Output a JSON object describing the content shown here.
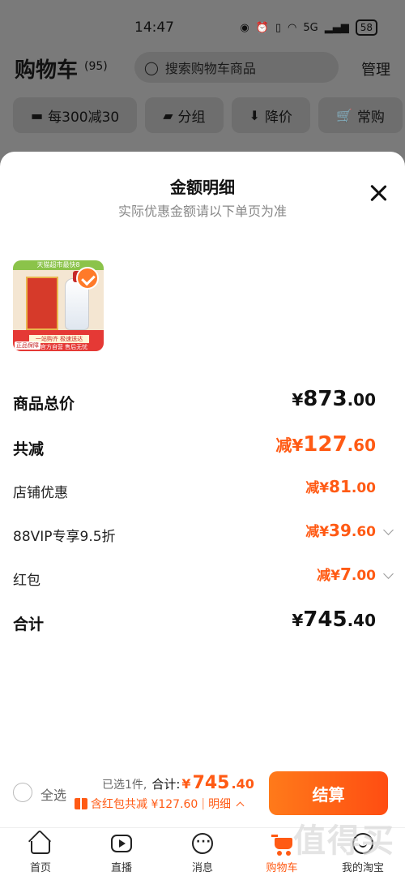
{
  "status_bar": {
    "time": "14:47",
    "network": "5G",
    "battery": "58"
  },
  "header": {
    "title": "购物车",
    "count": "(95)",
    "search_placeholder": "搜索购物车商品",
    "manage": "管理"
  },
  "chips": [
    {
      "label": "每300减30",
      "icon": "coupon-icon"
    },
    {
      "label": "分组",
      "icon": "folder-icon"
    },
    {
      "label": "降价",
      "icon": "price-down-icon"
    },
    {
      "label": "常购",
      "icon": "cart-icon"
    }
  ],
  "sheet": {
    "title": "金额明细",
    "subtitle": "实际优惠金额请以下单页为准",
    "product_thumb": {
      "banner": "天猫超市最快8",
      "strip": "一站购齐 极速送达",
      "strip2": "官方自营 售后无忧",
      "badge": "正品保障"
    },
    "rows": [
      {
        "label": "商品总价",
        "prefix": "",
        "yen": "¥",
        "int": "873",
        "dec": ".00"
      },
      {
        "label": "共减",
        "prefix": "减",
        "yen": "¥",
        "int": "127",
        "dec": ".60"
      },
      {
        "label": "店铺优惠",
        "prefix": "减",
        "yen": "¥",
        "int": "81",
        "dec": ".00"
      },
      {
        "label": "88VIP专享9.5折",
        "prefix": "减",
        "yen": "¥",
        "int": "39",
        "dec": ".60"
      },
      {
        "label": "红包",
        "prefix": "减",
        "yen": "¥",
        "int": "7",
        "dec": ".00"
      },
      {
        "label": "合计",
        "prefix": "",
        "yen": "¥",
        "int": "745",
        "dec": ".40"
      }
    ]
  },
  "bottom_bar": {
    "select_all": "全选",
    "selected": "已选1件,",
    "total_label": "合计:",
    "total_yen": "¥",
    "total_int": "745",
    "total_dec": ".40",
    "detail_text": "含红包共减 ¥127.60",
    "detail_sep": "|",
    "detail_link": "明细",
    "checkout": "结算"
  },
  "tabbar": [
    {
      "label": "首页",
      "icon": "home-icon"
    },
    {
      "label": "直播",
      "icon": "live-icon"
    },
    {
      "label": "消息",
      "icon": "message-icon"
    },
    {
      "label": "购物车",
      "icon": "cart-icon"
    },
    {
      "label": "我的淘宝",
      "icon": "profile-icon"
    }
  ],
  "watermark": "值得买"
}
